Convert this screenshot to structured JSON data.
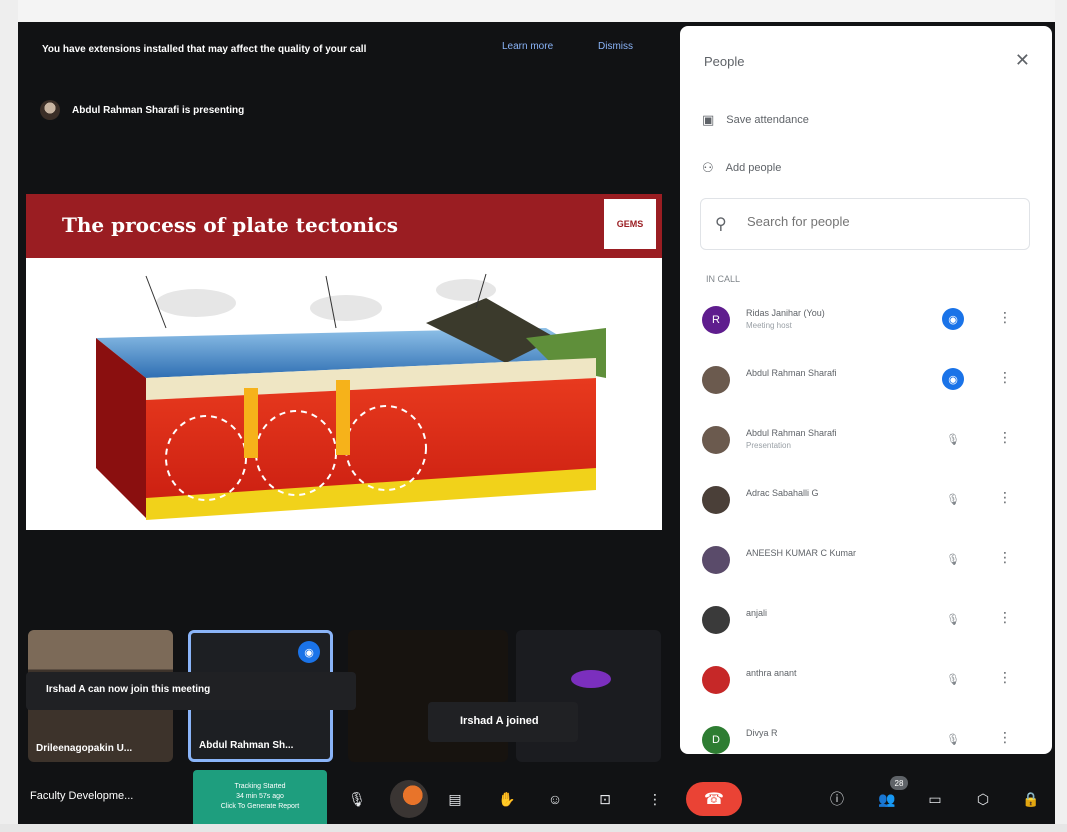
{
  "warning": {
    "text": "You have extensions installed that may affect the quality of your call",
    "learn_more": "Learn more",
    "dismiss": "Dismiss"
  },
  "presenting": {
    "text": "Abdul Rahman Sharafi is presenting"
  },
  "slide": {
    "title": "The process of plate tectonics",
    "logo_text": "GEMS"
  },
  "tiles": [
    {
      "name": "Drileenagopakin U..."
    },
    {
      "name": "Abdul Rahman Sh..."
    },
    {
      "name": ""
    },
    {
      "name": ""
    }
  ],
  "toasts": {
    "can_join": "Irshad A can now join this meeting",
    "joined": "Irshad A joined"
  },
  "panel": {
    "title": "People",
    "save_attendance": "Save attendance",
    "add_people": "Add people",
    "search_placeholder": "Search for people",
    "section": "IN CALL",
    "participants": [
      {
        "name": "Ridas Janihar (You)",
        "sub": "Meeting host",
        "initial": "R",
        "color": "#5f1d8e",
        "mic": "on"
      },
      {
        "name": "Abdul Rahman Sharafi",
        "sub": "",
        "initial": "",
        "color": "#6b5a4e",
        "mic": "on"
      },
      {
        "name": "Abdul Rahman Sharafi",
        "sub": "Presentation",
        "initial": "",
        "color": "#6b5a4e",
        "mic": "off"
      },
      {
        "name": "Adrac Sabahalli G",
        "sub": "",
        "initial": "",
        "color": "#4a3f38",
        "mic": "off"
      },
      {
        "name": "ANEESH KUMAR C Kumar",
        "sub": "",
        "initial": "",
        "color": "#5a4b6a",
        "mic": "off"
      },
      {
        "name": "anjali",
        "sub": "",
        "initial": "",
        "color": "#3a3a3a",
        "mic": "off"
      },
      {
        "name": "anthra anant",
        "sub": "",
        "initial": "",
        "color": "#c62828",
        "mic": "off"
      },
      {
        "name": "Divya R",
        "sub": "",
        "initial": "D",
        "color": "#2e7d32",
        "mic": "off"
      }
    ]
  },
  "bottom": {
    "meeting_title": "Faculty Developme...",
    "tracking_line1": "Tracking Started",
    "tracking_line2": "34 min 57s ago",
    "tracking_line3": "Click To Generate Report",
    "people_count": "28"
  }
}
